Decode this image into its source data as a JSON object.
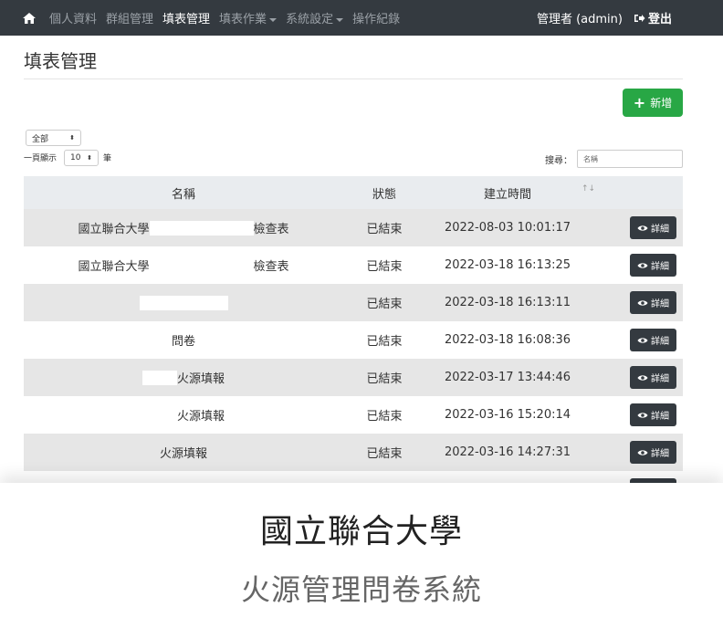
{
  "navbar": {
    "icon": "home-icon",
    "items": [
      {
        "label": "個人資料",
        "active": false,
        "dropdown": false
      },
      {
        "label": "群組管理",
        "active": false,
        "dropdown": false
      },
      {
        "label": "填表管理",
        "active": true,
        "dropdown": false
      },
      {
        "label": "填表作業",
        "active": false,
        "dropdown": true
      },
      {
        "label": "系統設定",
        "active": false,
        "dropdown": true
      },
      {
        "label": "操作紀錄",
        "active": false,
        "dropdown": false
      }
    ],
    "user": "管理者 (admin)",
    "logout": "登出"
  },
  "page": {
    "title": "填表管理",
    "add_button": "新增",
    "filter_value": "全部",
    "length_prefix": "一頁顯示",
    "length_value": "10",
    "length_suffix": "筆",
    "search_label": "搜尋：",
    "search_placeholder": "名稱"
  },
  "table": {
    "headers": {
      "name": "名稱",
      "status": "狀態",
      "time": "建立時間"
    },
    "detail_label": "詳細",
    "rows": [
      {
        "prefix": "國立聯合大學",
        "suffix": "檢查表",
        "status": "已結束",
        "time": "2022-08-03 10:01:17"
      },
      {
        "prefix": "國立聯合大學",
        "suffix": "檢查表",
        "status": "已結束",
        "time": "2022-03-18 16:13:25"
      },
      {
        "prefix": "",
        "suffix": "",
        "status": "已結束",
        "time": "2022-03-18 16:13:11"
      },
      {
        "prefix": "問卷",
        "suffix": "",
        "status": "已結束",
        "time": "2022-03-18 16:08:36"
      },
      {
        "prefix": "",
        "suffix": "火源填報",
        "status": "已結束",
        "time": "2022-03-17 13:44:46"
      },
      {
        "prefix": "",
        "suffix": "火源填報",
        "status": "已結束",
        "time": "2022-03-16 15:20:14"
      },
      {
        "prefix": "火源填報",
        "suffix": "",
        "status": "已結束",
        "time": "2022-03-16 14:27:31"
      }
    ]
  },
  "overlay": {
    "title": "國立聯合大學",
    "subtitle": "火源管理問卷系統"
  },
  "colors": {
    "navbar": "#343a40",
    "add_button": "#28a745",
    "table_header": "#e9ecef",
    "row_stripe": "#e6e6e6",
    "detail_button": "#343a40"
  }
}
